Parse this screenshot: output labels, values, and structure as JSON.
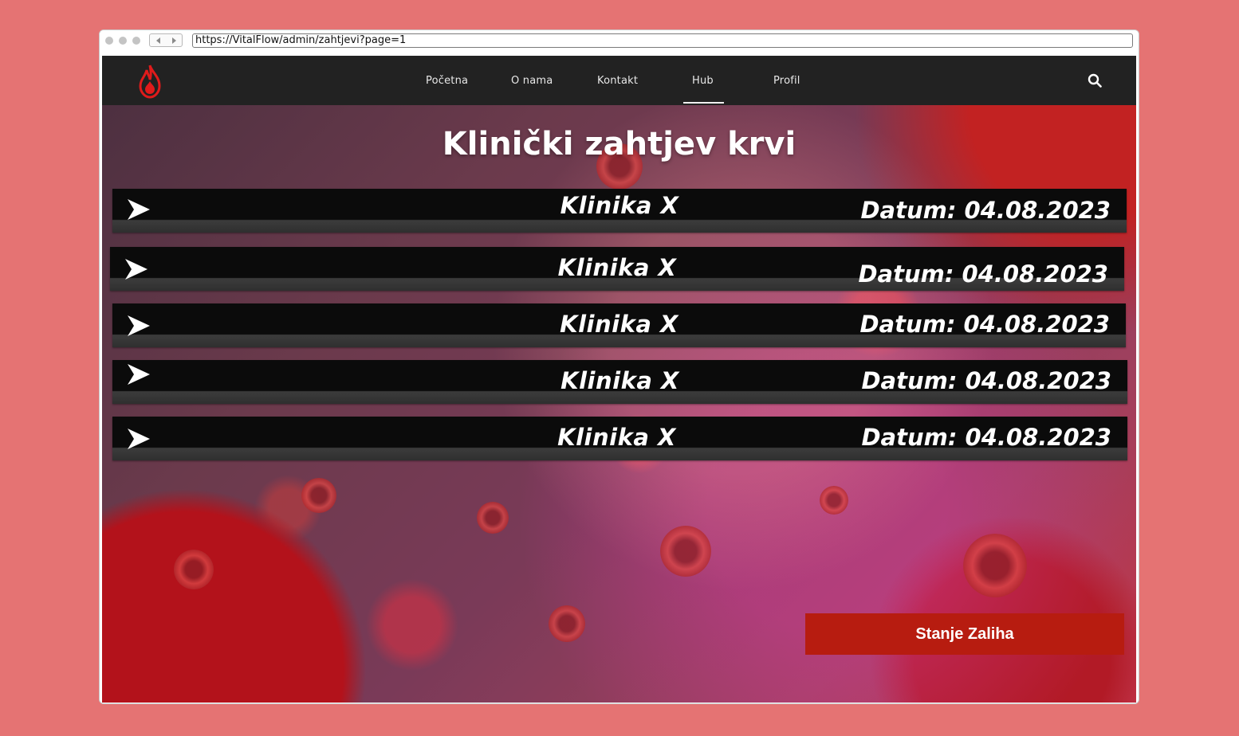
{
  "browser": {
    "url": "https://VitalFlow/admin/zahtjevi?page=1"
  },
  "nav": {
    "items": [
      {
        "label": "Početna"
      },
      {
        "label": "O nama"
      },
      {
        "label": "Kontakt"
      },
      {
        "label": "Hub"
      },
      {
        "label": "Profil"
      }
    ],
    "active": "Hub"
  },
  "main": {
    "title": "Klinički zahtjev krvi",
    "requests": [
      {
        "clinic": "Klinika X",
        "date": "Datum: 04.08.2023"
      },
      {
        "clinic": "Klinika X",
        "date": "Datum: 04.08.2023"
      },
      {
        "clinic": "Klinika X",
        "date": "Datum: 04.08.2023"
      },
      {
        "clinic": "Klinika X",
        "date": "Datum: 04.08.2023"
      },
      {
        "clinic": "Klinika X",
        "date": "Datum: 04.08.2023"
      }
    ],
    "cta_label": "Stanje Zaliha"
  },
  "icons": {
    "logo": "blood-drop-flame-icon",
    "search": "search-icon",
    "row_arrow": "arrow-right-icon"
  },
  "colors": {
    "page_background": "#e57373",
    "navbar": "#222222",
    "accent_red": "#b71c10",
    "row_background": "#0b0b0b"
  }
}
